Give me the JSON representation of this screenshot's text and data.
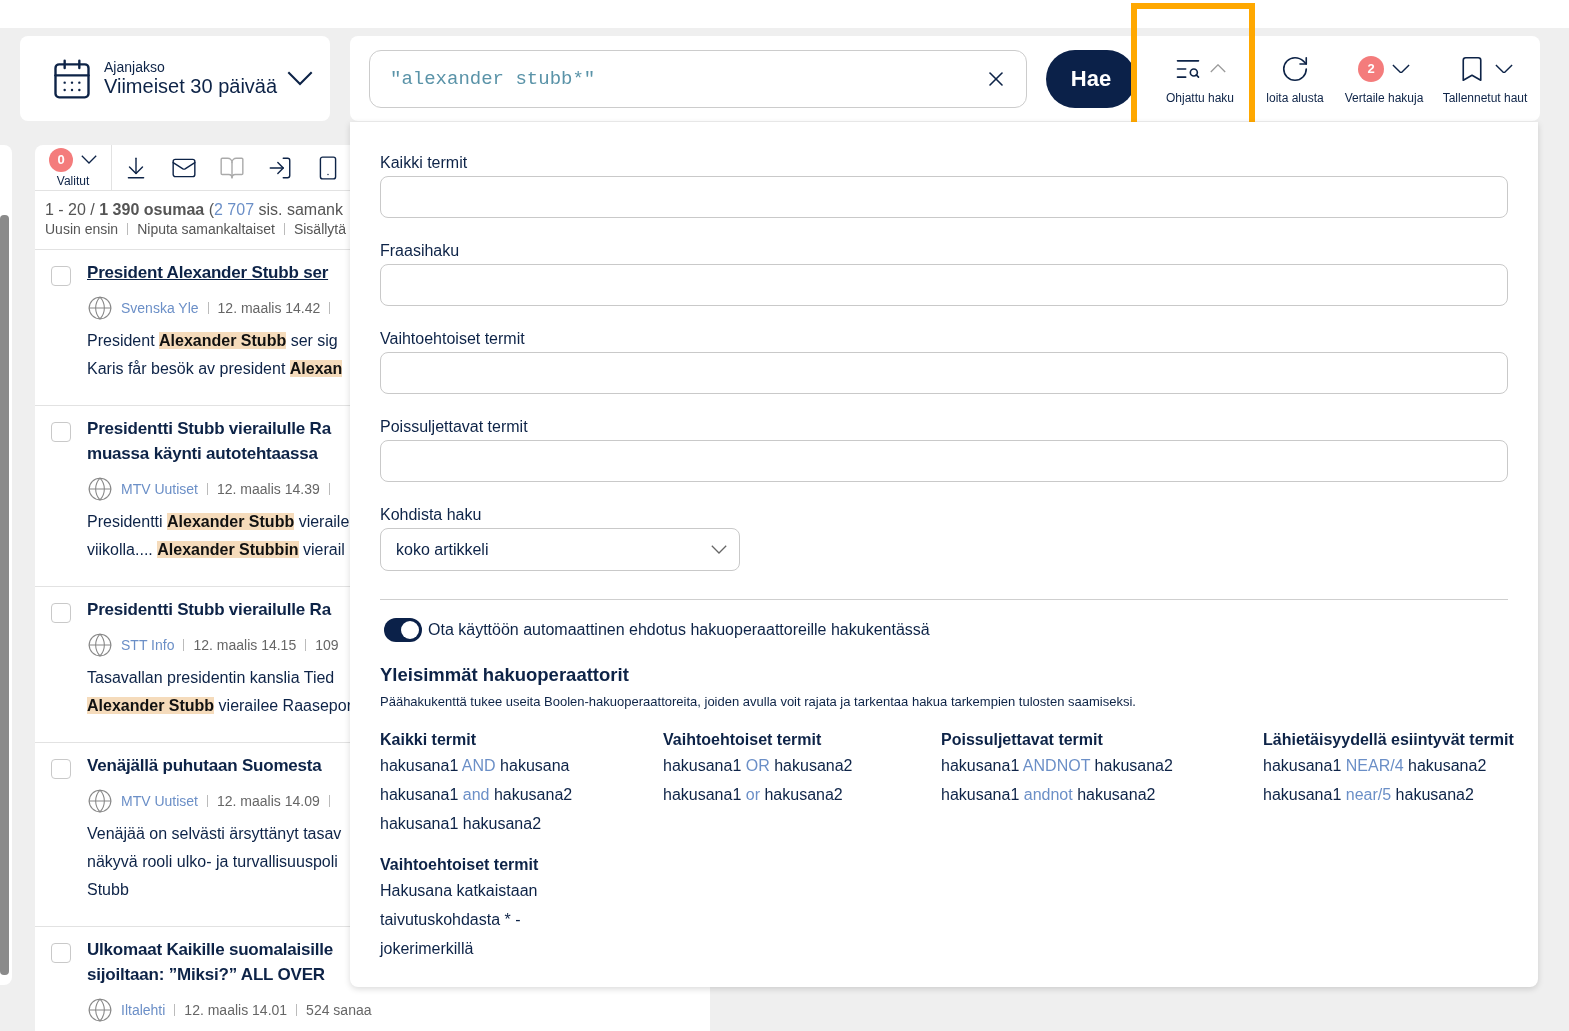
{
  "period": {
    "label": "Ajanjakso",
    "value": "Viimeiset 30 päivää"
  },
  "search": {
    "value": "\"alexander stubb*\"",
    "button": "Hae"
  },
  "tools": [
    {
      "kind": "guided",
      "label": "Ohjattu haku",
      "expanded": true,
      "highlighted": true
    },
    {
      "kind": "reset",
      "label": "loita alusta",
      "highlighted": false
    },
    {
      "kind": "compare",
      "label": "Vertaile hakuja",
      "badge": "2",
      "expanded": false,
      "highlighted": false
    },
    {
      "kind": "saved",
      "label": "Tallennetut haut",
      "expanded": false,
      "highlighted": false
    }
  ],
  "results": {
    "selected_count": "0",
    "selected_label": "Valitut",
    "actions": [
      {
        "kind": "download",
        "disabled": false
      },
      {
        "kind": "mail",
        "disabled": false
      },
      {
        "kind": "reader",
        "disabled": true
      },
      {
        "kind": "export",
        "disabled": false
      },
      {
        "kind": "devices",
        "disabled": false
      }
    ],
    "summary": "1 - 20 / **1 390 osumaa** (",
    "similar_link": "2 707",
    "summary_rest": "sis. samank",
    "sort_options": [
      "Uusin ensin",
      "Niputa samankaltaiset",
      "Sisällytä"
    ],
    "items": [
      {
        "title": [
          "President Alexander Stubb ser"
        ],
        "visited": true,
        "checked": false,
        "source": "Svenska Yle",
        "date": "12. maalis 14.42",
        "cut": true,
        "snippet": [
          "President **Alexander Stubb** ser sig",
          "Karis får besök av president **Alexan**"
        ]
      },
      {
        "title": [
          "Presidentti Stubb vierailulle Ra",
          "muassa käynti autotehtaassa"
        ],
        "visited": false,
        "checked": false,
        "source": "MTV Uutiset",
        "date": "12. maalis 14.39",
        "cut": true,
        "snippet": [
          "Presidentti **Alexander Stubb** vieraile",
          "viikolla.... **Alexander Stubbin** vierail"
        ]
      },
      {
        "title": [
          "Presidentti Stubb vierailulle Ra"
        ],
        "visited": false,
        "checked": false,
        "source": "STT Info",
        "date": "12. maalis 14.15",
        "words": "109",
        "cut": false,
        "snippet": [
          "Tasavallan presidentin kanslia Tied",
          "**Alexander Stubb** vierailee Raasepor"
        ]
      },
      {
        "title": [
          "Venäjällä puhutaan Suomesta"
        ],
        "visited": false,
        "checked": false,
        "source": "MTV Uutiset",
        "date": "12. maalis 14.09",
        "cut": true,
        "snippet": [
          "Venäjää on selvästi ärsyttänyt tasav",
          "näkyvä rooli ulko- ja turvallisuuspoli",
          "Stubb"
        ]
      },
      {
        "title": [
          "Ulkomaat Kaikille suomalaisille",
          "sijoiltaan: ”Miksi?” ALL OVER"
        ],
        "visited": false,
        "checked": false,
        "source": "Iltalehti",
        "date": "12. maalis 14.01",
        "words": "524 sanaa",
        "cut": false
      }
    ]
  },
  "panel": {
    "fields": [
      {
        "label": "Kaikki termit"
      },
      {
        "label": "Fraasihaku"
      },
      {
        "label": "Vaihtoehtoiset termit"
      },
      {
        "label": "Poissuljettavat termit"
      }
    ],
    "target": {
      "label": "Kohdista haku",
      "value": "koko artikkeli"
    },
    "auto_suggest": {
      "label": "Ota käyttöön automaattinen ehdotus hakuoperaattoreille hakukentässä",
      "on": true
    },
    "heading": "Yleisimmät hakuoperaattorit",
    "description": "Päähakukenttä tukee useita Boolen-hakuoperaattoreita, joiden avulla voit rajata ja tarkentaa hakua tarkempien tulosten saamiseksi.",
    "operators": [
      {
        "title": "Kaikki termit",
        "examples": [
          [
            "hakusana1",
            "AND",
            "hakusana"
          ],
          [
            "hakusana1",
            "and",
            "hakusana2"
          ],
          [
            "hakusana1",
            "hakusana2"
          ]
        ]
      },
      {
        "title": "Vaihtoehtoiset termit",
        "examples": [
          [
            "hakusana1",
            "OR",
            "hakusana2"
          ],
          [
            "hakusana1",
            "or",
            "hakusana2"
          ]
        ]
      },
      {
        "title": "Poissuljettavat termit",
        "examples": [
          [
            "hakusana1",
            "ANDNOT",
            "hakusana2"
          ],
          [
            "hakusana1",
            "andnot",
            "hakusana2"
          ]
        ]
      },
      {
        "title": "Lähietäisyydellä esiintyvät termit",
        "examples": [
          [
            "hakusana1",
            "NEAR/4",
            "hakusana2"
          ],
          [
            "hakusana1",
            "near/5",
            "hakusana2"
          ]
        ]
      }
    ],
    "truncation": {
      "title": "Vaihtoehtoiset termit",
      "text": "Hakusana katkaistaan taivutuskohdasta * -jokerimerkillä"
    }
  }
}
